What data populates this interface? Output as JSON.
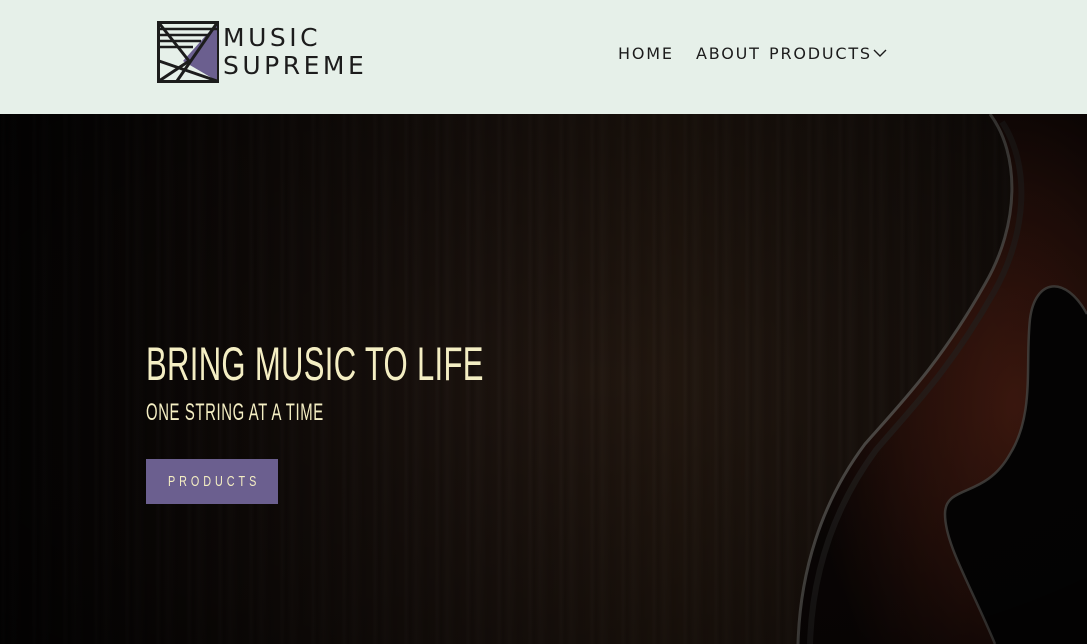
{
  "header": {
    "logo": {
      "line1": "MUSIC",
      "line2": "SUPREME",
      "mark_icon": "music-supreme-logo-mark",
      "mark_color": "#6b5f8f"
    },
    "nav": {
      "home": "HOME",
      "about": "ABOUT",
      "products": "PRODUCTS",
      "products_dropdown_icon": "chevron-down-icon"
    },
    "background_color": "#e6f0e9"
  },
  "hero": {
    "title": "BRING MUSIC TO LIFE",
    "subtitle": "ONE STRING AT A TIME",
    "button_label": "PRODUCTS",
    "button_color": "#6b5f8f",
    "text_color": "#f4eec3",
    "background_image": "dark-wood-guitar"
  }
}
